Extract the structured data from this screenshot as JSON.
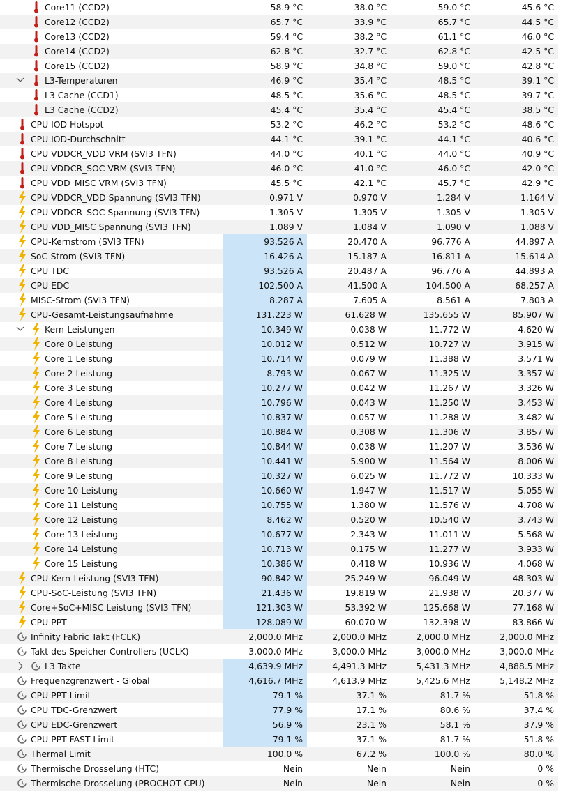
{
  "icons": {
    "temp": "thermometer-icon",
    "volt": "lightning-icon",
    "clock": "clock-icon"
  },
  "colors": {
    "thermometer": "#c0201a",
    "lightning": "#f0b400",
    "clock": "#666666",
    "highlight": "#cce4f7"
  },
  "rows": [
    {
      "name": "Core11 (CCD2)",
      "icon": "temp",
      "indent": 2,
      "values": [
        "58.9 °C",
        "38.0 °C",
        "59.0 °C",
        "45.6 °C"
      ]
    },
    {
      "name": "Core12 (CCD2)",
      "icon": "temp",
      "indent": 2,
      "values": [
        "65.7 °C",
        "33.9 °C",
        "65.7 °C",
        "44.5 °C"
      ]
    },
    {
      "name": "Core13 (CCD2)",
      "icon": "temp",
      "indent": 2,
      "values": [
        "59.4 °C",
        "38.2 °C",
        "61.1 °C",
        "46.0 °C"
      ]
    },
    {
      "name": "Core14 (CCD2)",
      "icon": "temp",
      "indent": 2,
      "values": [
        "62.8 °C",
        "32.7 °C",
        "62.8 °C",
        "42.5 °C"
      ]
    },
    {
      "name": "Core15 (CCD2)",
      "icon": "temp",
      "indent": 2,
      "values": [
        "58.9 °C",
        "34.8 °C",
        "59.0 °C",
        "42.8 °C"
      ]
    },
    {
      "name": "L3-Temperaturen",
      "icon": "temp",
      "indent": 2,
      "chevron": "expanded",
      "values": [
        "46.9 °C",
        "35.4 °C",
        "48.5 °C",
        "39.1 °C"
      ]
    },
    {
      "name": "L3 Cache (CCD1)",
      "icon": "temp",
      "indent": 2,
      "values": [
        "48.5 °C",
        "35.6 °C",
        "48.5 °C",
        "39.7 °C"
      ]
    },
    {
      "name": "L3 Cache (CCD2)",
      "icon": "temp",
      "indent": 2,
      "values": [
        "45.4 °C",
        "35.4 °C",
        "45.4 °C",
        "38.5 °C"
      ]
    },
    {
      "name": "CPU IOD Hotspot",
      "icon": "temp",
      "indent": 1,
      "values": [
        "53.2 °C",
        "46.2 °C",
        "53.2 °C",
        "48.6 °C"
      ]
    },
    {
      "name": "CPU IOD-Durchschnitt",
      "icon": "temp",
      "indent": 1,
      "values": [
        "44.1 °C",
        "39.1 °C",
        "44.1 °C",
        "40.6 °C"
      ]
    },
    {
      "name": "CPU VDDCR_VDD VRM (SVI3 TFN)",
      "icon": "temp",
      "indent": 1,
      "values": [
        "44.0 °C",
        "40.1 °C",
        "44.0 °C",
        "40.9 °C"
      ]
    },
    {
      "name": "CPU VDDCR_SOC VRM (SVI3 TFN)",
      "icon": "temp",
      "indent": 1,
      "values": [
        "46.0 °C",
        "41.0 °C",
        "46.0 °C",
        "42.0 °C"
      ]
    },
    {
      "name": "CPU VDD_MISC VRM (SVI3 TFN)",
      "icon": "temp",
      "indent": 1,
      "values": [
        "45.5 °C",
        "42.1 °C",
        "45.7 °C",
        "42.9 °C"
      ]
    },
    {
      "name": "CPU VDDCR_VDD Spannung (SVI3 TFN)",
      "icon": "volt",
      "indent": 1,
      "values": [
        "0.971 V",
        "0.970 V",
        "1.284 V",
        "1.164 V"
      ]
    },
    {
      "name": "CPU VDDCR_SOC Spannung (SVI3 TFN)",
      "icon": "volt",
      "indent": 1,
      "values": [
        "1.305 V",
        "1.305 V",
        "1.305 V",
        "1.305 V"
      ]
    },
    {
      "name": "CPU VDD_MISC Spannung (SVI3 TFN)",
      "icon": "volt",
      "indent": 1,
      "values": [
        "1.089 V",
        "1.084 V",
        "1.090 V",
        "1.088 V"
      ]
    },
    {
      "name": "CPU-Kernstrom (SVI3 TFN)",
      "icon": "volt",
      "indent": 1,
      "hl": true,
      "values": [
        "93.526 A",
        "20.470 A",
        "96.776 A",
        "44.897 A"
      ]
    },
    {
      "name": "SoC-Strom (SVI3 TFN)",
      "icon": "volt",
      "indent": 1,
      "hl": true,
      "values": [
        "16.426 A",
        "15.187 A",
        "16.811 A",
        "15.614 A"
      ]
    },
    {
      "name": "CPU TDC",
      "icon": "volt",
      "indent": 1,
      "hl": true,
      "values": [
        "93.526 A",
        "20.487 A",
        "96.776 A",
        "44.893 A"
      ]
    },
    {
      "name": "CPU EDC",
      "icon": "volt",
      "indent": 1,
      "hl": true,
      "values": [
        "102.500 A",
        "41.500 A",
        "104.500 A",
        "68.257 A"
      ]
    },
    {
      "name": "MISC-Strom (SVI3 TFN)",
      "icon": "volt",
      "indent": 1,
      "hl": true,
      "values": [
        "8.287 A",
        "7.605 A",
        "8.561 A",
        "7.803 A"
      ]
    },
    {
      "name": "CPU-Gesamt-Leistungsaufnahme",
      "icon": "volt",
      "indent": 1,
      "hl": true,
      "values": [
        "131.223 W",
        "61.628 W",
        "135.655 W",
        "85.907 W"
      ]
    },
    {
      "name": "Kern-Leistungen",
      "icon": "volt",
      "indent": 2,
      "chevron": "expanded",
      "hl": true,
      "values": [
        "10.349 W",
        "0.038 W",
        "11.772 W",
        "4.620 W"
      ]
    },
    {
      "name": "Core 0 Leistung",
      "icon": "volt",
      "indent": 2,
      "hl": true,
      "values": [
        "10.012 W",
        "0.512 W",
        "10.727 W",
        "3.915 W"
      ]
    },
    {
      "name": "Core 1 Leistung",
      "icon": "volt",
      "indent": 2,
      "hl": true,
      "values": [
        "10.714 W",
        "0.079 W",
        "11.388 W",
        "3.571 W"
      ]
    },
    {
      "name": "Core 2 Leistung",
      "icon": "volt",
      "indent": 2,
      "hl": true,
      "values": [
        "8.793 W",
        "0.067 W",
        "11.325 W",
        "3.357 W"
      ]
    },
    {
      "name": "Core 3 Leistung",
      "icon": "volt",
      "indent": 2,
      "hl": true,
      "values": [
        "10.277 W",
        "0.042 W",
        "11.267 W",
        "3.326 W"
      ]
    },
    {
      "name": "Core 4 Leistung",
      "icon": "volt",
      "indent": 2,
      "hl": true,
      "values": [
        "10.796 W",
        "0.043 W",
        "11.250 W",
        "3.453 W"
      ]
    },
    {
      "name": "Core 5 Leistung",
      "icon": "volt",
      "indent": 2,
      "hl": true,
      "values": [
        "10.837 W",
        "0.057 W",
        "11.288 W",
        "3.482 W"
      ]
    },
    {
      "name": "Core 6 Leistung",
      "icon": "volt",
      "indent": 2,
      "hl": true,
      "values": [
        "10.884 W",
        "0.308 W",
        "11.306 W",
        "3.857 W"
      ]
    },
    {
      "name": "Core 7 Leistung",
      "icon": "volt",
      "indent": 2,
      "hl": true,
      "values": [
        "10.844 W",
        "0.038 W",
        "11.207 W",
        "3.536 W"
      ]
    },
    {
      "name": "Core 8 Leistung",
      "icon": "volt",
      "indent": 2,
      "hl": true,
      "values": [
        "10.441 W",
        "5.900 W",
        "11.564 W",
        "8.006 W"
      ]
    },
    {
      "name": "Core 9 Leistung",
      "icon": "volt",
      "indent": 2,
      "hl": true,
      "values": [
        "10.327 W",
        "6.025 W",
        "11.772 W",
        "10.333 W"
      ]
    },
    {
      "name": "Core 10 Leistung",
      "icon": "volt",
      "indent": 2,
      "hl": true,
      "values": [
        "10.660 W",
        "1.947 W",
        "11.517 W",
        "5.055 W"
      ]
    },
    {
      "name": "Core 11 Leistung",
      "icon": "volt",
      "indent": 2,
      "hl": true,
      "values": [
        "10.755 W",
        "1.380 W",
        "11.576 W",
        "4.708 W"
      ]
    },
    {
      "name": "Core 12 Leistung",
      "icon": "volt",
      "indent": 2,
      "hl": true,
      "values": [
        "8.462 W",
        "0.520 W",
        "10.540 W",
        "3.743 W"
      ]
    },
    {
      "name": "Core 13 Leistung",
      "icon": "volt",
      "indent": 2,
      "hl": true,
      "values": [
        "10.677 W",
        "2.343 W",
        "11.011 W",
        "5.568 W"
      ]
    },
    {
      "name": "Core 14 Leistung",
      "icon": "volt",
      "indent": 2,
      "hl": true,
      "values": [
        "10.713 W",
        "0.175 W",
        "11.277 W",
        "3.933 W"
      ]
    },
    {
      "name": "Core 15 Leistung",
      "icon": "volt",
      "indent": 2,
      "hl": true,
      "values": [
        "10.386 W",
        "0.418 W",
        "10.936 W",
        "4.068 W"
      ]
    },
    {
      "name": "CPU Kern-Leistung (SVI3 TFN)",
      "icon": "volt",
      "indent": 1,
      "hl": true,
      "values": [
        "90.842 W",
        "25.249 W",
        "96.049 W",
        "48.303 W"
      ]
    },
    {
      "name": "CPU-SoC-Leistung (SVI3 TFN)",
      "icon": "volt",
      "indent": 1,
      "hl": true,
      "values": [
        "21.436 W",
        "19.819 W",
        "21.938 W",
        "20.377 W"
      ]
    },
    {
      "name": "Core+SoC+MISC Leistung (SVI3 TFN)",
      "icon": "volt",
      "indent": 1,
      "hl": true,
      "values": [
        "121.303 W",
        "53.392 W",
        "125.668 W",
        "77.168 W"
      ]
    },
    {
      "name": "CPU PPT",
      "icon": "volt",
      "indent": 1,
      "hl": true,
      "values": [
        "128.089 W",
        "60.070 W",
        "132.398 W",
        "83.866 W"
      ]
    },
    {
      "name": "Infinity Fabric Takt (FCLK)",
      "icon": "clock",
      "indent": 1,
      "values": [
        "2,000.0 MHz",
        "2,000.0 MHz",
        "2,000.0 MHz",
        "2,000.0 MHz"
      ]
    },
    {
      "name": "Takt des Speicher-Controllers (UCLK)",
      "icon": "clock",
      "indent": 1,
      "values": [
        "3,000.0 MHz",
        "3,000.0 MHz",
        "3,000.0 MHz",
        "3,000.0 MHz"
      ]
    },
    {
      "name": "L3 Takte",
      "icon": "clock",
      "indent": 2,
      "chevron": "collapsed",
      "hl": true,
      "values": [
        "4,639.9 MHz",
        "4,491.3 MHz",
        "5,431.3 MHz",
        "4,888.5 MHz"
      ]
    },
    {
      "name": "Frequenzgrenzwert - Global",
      "icon": "clock",
      "indent": 1,
      "hl": true,
      "values": [
        "4,616.7 MHz",
        "4,613.9 MHz",
        "5,425.6 MHz",
        "5,148.2 MHz"
      ]
    },
    {
      "name": "CPU PPT Limit",
      "icon": "clock",
      "indent": 1,
      "hl": true,
      "values": [
        "79.1 %",
        "37.1 %",
        "81.7 %",
        "51.8 %"
      ]
    },
    {
      "name": "CPU TDC-Grenzwert",
      "icon": "clock",
      "indent": 1,
      "hl": true,
      "values": [
        "77.9 %",
        "17.1 %",
        "80.6 %",
        "37.4 %"
      ]
    },
    {
      "name": "CPU EDC-Grenzwert",
      "icon": "clock",
      "indent": 1,
      "hl": true,
      "values": [
        "56.9 %",
        "23.1 %",
        "58.1 %",
        "37.9 %"
      ]
    },
    {
      "name": "CPU PPT FAST Limit",
      "icon": "clock",
      "indent": 1,
      "hl": true,
      "values": [
        "79.1 %",
        "37.1 %",
        "81.7 %",
        "51.8 %"
      ]
    },
    {
      "name": "Thermal Limit",
      "icon": "clock",
      "indent": 1,
      "values": [
        "100.0 %",
        "67.2 %",
        "100.0 %",
        "80.0 %"
      ]
    },
    {
      "name": "Thermische Drosselung (HTC)",
      "icon": "clock",
      "indent": 1,
      "values": [
        "Nein",
        "Nein",
        "Nein",
        "0 %"
      ]
    },
    {
      "name": "Thermische Drosselung (PROCHOT CPU)",
      "icon": "clock",
      "indent": 1,
      "values": [
        "Nein",
        "Nein",
        "Nein",
        "0 %"
      ]
    }
  ]
}
